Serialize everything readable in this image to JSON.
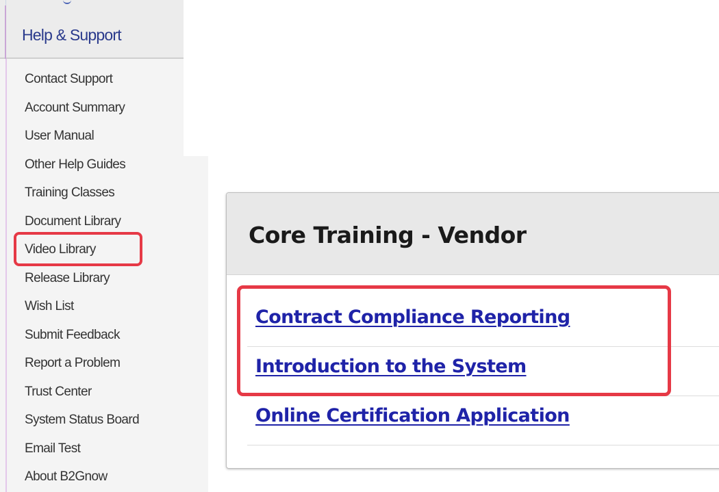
{
  "help_menu": {
    "title": "Help & Support",
    "items": [
      {
        "label": "Contact Support"
      },
      {
        "label": "Account Summary"
      },
      {
        "label": "User Manual"
      },
      {
        "label": "Other Help Guides"
      },
      {
        "label": "Training Classes"
      },
      {
        "label": "Document Library"
      },
      {
        "label": "Video Library",
        "highlighted": true
      },
      {
        "label": "Release Library"
      },
      {
        "label": "Wish List"
      },
      {
        "label": "Submit Feedback"
      },
      {
        "label": "Report a Problem"
      },
      {
        "label": "Trust Center"
      },
      {
        "label": "System Status Board"
      },
      {
        "label": "Email Test"
      },
      {
        "label": "About B2Gnow"
      }
    ]
  },
  "training_panel": {
    "title": "Core Training - Vendor",
    "links": [
      {
        "label": "Contract Compliance Reporting",
        "highlighted": true
      },
      {
        "label": "Introduction to the System",
        "highlighted": true
      },
      {
        "label": "Online Certification Application",
        "highlighted": false
      }
    ]
  },
  "colors": {
    "highlight": "#e63946",
    "link": "#1f23a8",
    "menu_title": "#2a3a8c"
  }
}
